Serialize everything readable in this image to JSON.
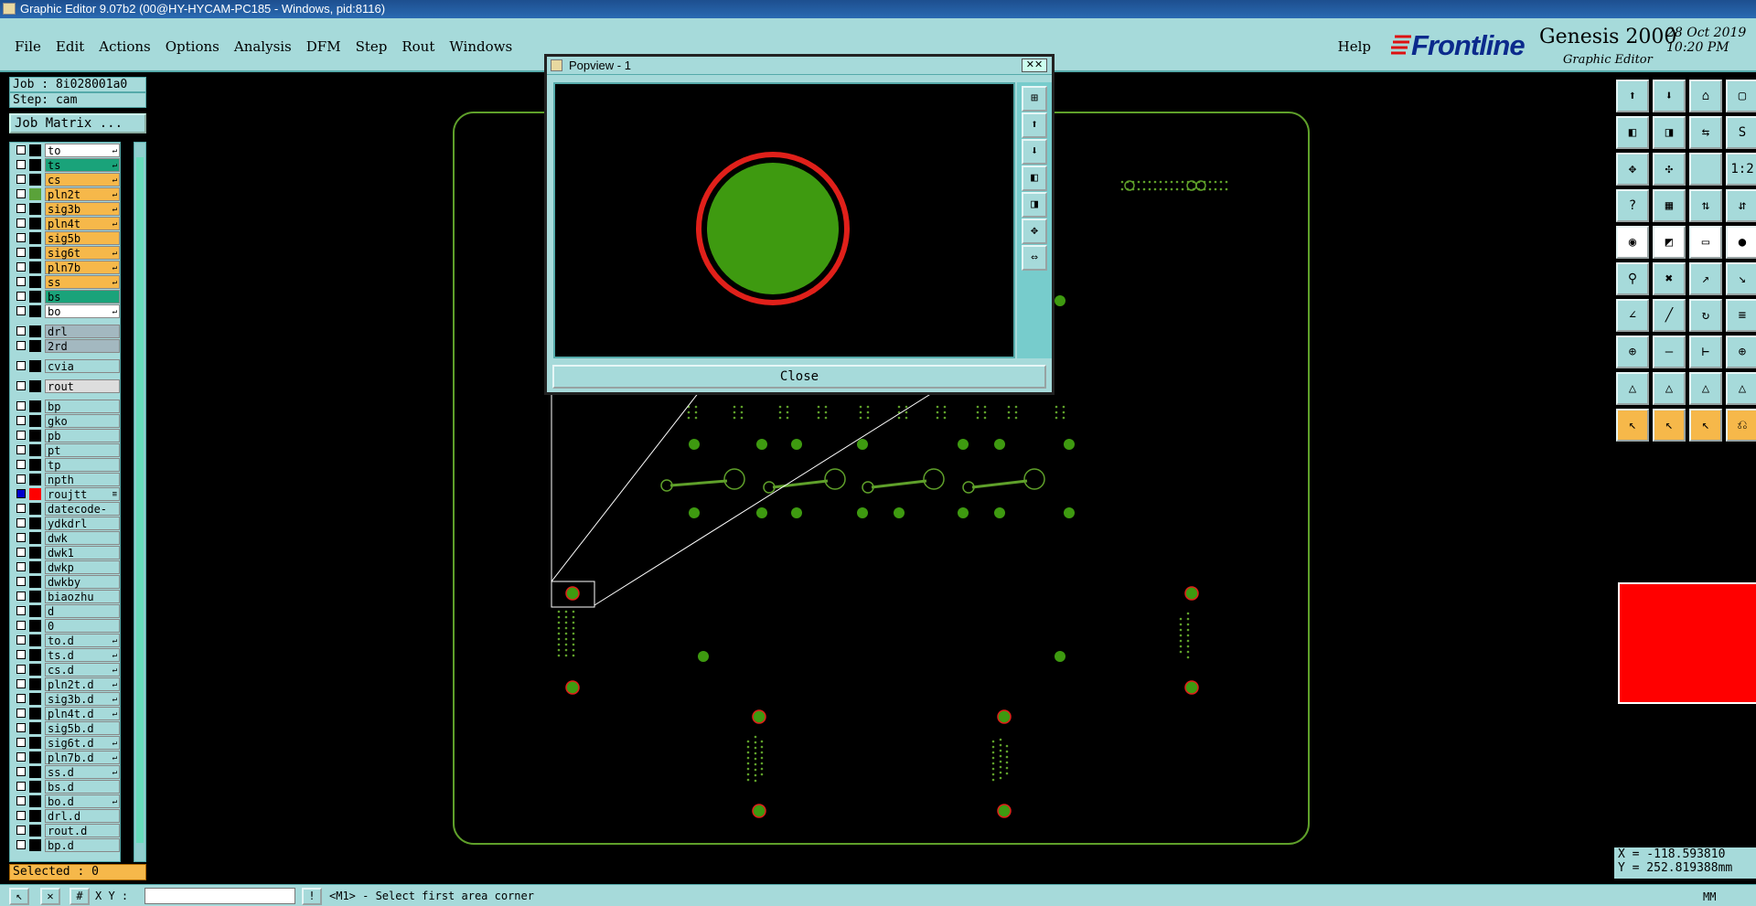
{
  "window": {
    "title": "Graphic Editor 9.07b2 (00@HY-HYCAM-PC185 - Windows, pid:8116)"
  },
  "menu": {
    "items": [
      "File",
      "Edit",
      "Actions",
      "Options",
      "Analysis",
      "DFM",
      "Step",
      "Rout",
      "Windows"
    ],
    "help": "Help"
  },
  "brand": {
    "name": "Frontline",
    "product": "Genesis 2000",
    "subtitle": "Graphic Editor",
    "date": "28 Oct 2019",
    "time": "10:20 PM"
  },
  "job": {
    "job": "Job : 8i028001a0",
    "step": "Step: cam",
    "matrix_button": "Job Matrix ..."
  },
  "layers": [
    {
      "name": "to",
      "color": "#ffffff",
      "flag": "↵"
    },
    {
      "name": "ts",
      "color": "#1aa37a",
      "flag": "↵"
    },
    {
      "name": "cs",
      "color": "#f6b84a",
      "flag": "↵"
    },
    {
      "name": "pln2t",
      "color": "#f6b84a",
      "flag": "↵",
      "active": true
    },
    {
      "name": "sig3b",
      "color": "#f6b84a",
      "flag": "↵"
    },
    {
      "name": "pln4t",
      "color": "#f6b84a",
      "flag": "↵"
    },
    {
      "name": "sig5b",
      "color": "#f6b84a",
      "flag": ""
    },
    {
      "name": "sig6t",
      "color": "#f6b84a",
      "flag": "↵"
    },
    {
      "name": "pln7b",
      "color": "#f6b84a",
      "flag": "↵"
    },
    {
      "name": "ss",
      "color": "#f6b84a",
      "flag": "↵"
    },
    {
      "name": "bs",
      "color": "#1aa37a",
      "flag": ""
    },
    {
      "name": "bo",
      "color": "#ffffff",
      "flag": "↵"
    },
    {
      "name": "drl",
      "color": "#a3b8c0",
      "flag": "",
      "gap": true
    },
    {
      "name": "2rd",
      "color": "#a3b8c0",
      "flag": ""
    },
    {
      "name": "cvia",
      "color": "#a6dada",
      "flag": "",
      "gap": true
    },
    {
      "name": "rout",
      "color": "#dddddd",
      "flag": "",
      "gap": true
    },
    {
      "name": "bp",
      "color": "#a6dada",
      "flag": "",
      "gap": true
    },
    {
      "name": "gko",
      "color": "#a6dada",
      "flag": ""
    },
    {
      "name": "pb",
      "color": "#a6dada",
      "flag": ""
    },
    {
      "name": "pt",
      "color": "#a6dada",
      "flag": ""
    },
    {
      "name": "tp",
      "color": "#a6dada",
      "flag": ""
    },
    {
      "name": "npth",
      "color": "#a6dada",
      "flag": ""
    },
    {
      "name": "roujtt",
      "color": "#a6dada",
      "flag": "≡",
      "red": true
    },
    {
      "name": "datecode-ptc",
      "color": "#a6dada",
      "flag": ""
    },
    {
      "name": "ydkdrl",
      "color": "#a6dada",
      "flag": ""
    },
    {
      "name": "dwk",
      "color": "#a6dada",
      "flag": ""
    },
    {
      "name": "dwk1",
      "color": "#a6dada",
      "flag": ""
    },
    {
      "name": "dwkp",
      "color": "#a6dada",
      "flag": ""
    },
    {
      "name": "dwkby",
      "color": "#a6dada",
      "flag": ""
    },
    {
      "name": "biaozhu",
      "color": "#a6dada",
      "flag": ""
    },
    {
      "name": "d",
      "color": "#a6dada",
      "flag": ""
    },
    {
      "name": "0",
      "color": "#a6dada",
      "flag": ""
    },
    {
      "name": "to.d",
      "color": "#a6dada",
      "flag": "↵"
    },
    {
      "name": "ts.d",
      "color": "#a6dada",
      "flag": "↵"
    },
    {
      "name": "cs.d",
      "color": "#a6dada",
      "flag": "↵"
    },
    {
      "name": "pln2t.d",
      "color": "#a6dada",
      "flag": "↵"
    },
    {
      "name": "sig3b.d",
      "color": "#a6dada",
      "flag": "↵"
    },
    {
      "name": "pln4t.d",
      "color": "#a6dada",
      "flag": "↵"
    },
    {
      "name": "sig5b.d",
      "color": "#a6dada",
      "flag": ""
    },
    {
      "name": "sig6t.d",
      "color": "#a6dada",
      "flag": "↵"
    },
    {
      "name": "pln7b.d",
      "color": "#a6dada",
      "flag": "↵"
    },
    {
      "name": "ss.d",
      "color": "#a6dada",
      "flag": "↵"
    },
    {
      "name": "bs.d",
      "color": "#a6dada",
      "flag": ""
    },
    {
      "name": "bo.d",
      "color": "#a6dada",
      "flag": "↵"
    },
    {
      "name": "drl.d",
      "color": "#a6dada",
      "flag": ""
    },
    {
      "name": "rout.d",
      "color": "#a6dada",
      "flag": ""
    },
    {
      "name": "bp.d",
      "color": "#a6dada",
      "flag": ""
    }
  ],
  "selected": "Selected : 0",
  "popview": {
    "title": "Popview - 1",
    "close_label": "Close",
    "tool_icons": [
      "zoom-fit",
      "zoom-in-up",
      "zoom-in-down",
      "zoom-left",
      "zoom-right",
      "zoom-home",
      "zoom-page"
    ]
  },
  "tools": {
    "row_labels": [
      "",
      "",
      "",
      "",
      "",
      "",
      "",
      "",
      "",
      "",
      "",
      "1:2",
      "?",
      "",
      "",
      "",
      "",
      "",
      "",
      "",
      "",
      "",
      "",
      "",
      "",
      "",
      "",
      "",
      "",
      "",
      "",
      "",
      "",
      "",
      "",
      "",
      "",
      "",
      "",
      "",
      "",
      ""
    ]
  },
  "coords": {
    "x": "X = -118.593810",
    "y": "Y = 252.819388mm"
  },
  "status": {
    "xy_label": "X Y :",
    "message": "<M1> - Select first area corner",
    "units": "MM"
  },
  "colors": {
    "panel": "#a6dada",
    "board": "#5fa02a",
    "pad_red": "#e0201a",
    "pad_green": "#3e9a10"
  }
}
